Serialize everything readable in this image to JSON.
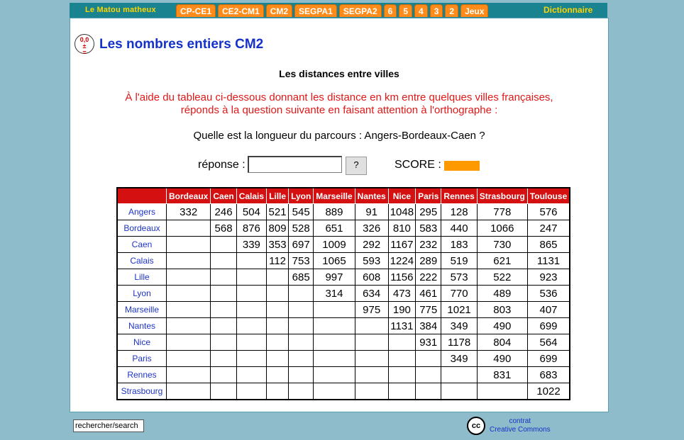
{
  "nav": {
    "brand": "Le Matou matheux",
    "tabs": [
      "CP-CE1",
      "CE2-CM1",
      "CM2",
      "SEGPA1",
      "SEGPA2",
      "6",
      "5",
      "4",
      "3",
      "2",
      "Jeux"
    ],
    "dictionary": "Dictionnaire"
  },
  "page": {
    "logo_text": "0,0\n+-\n=",
    "title": "Les nombres entiers CM2",
    "subtitle": "Les distances entre villes",
    "instructions_line1": "À l'aide du tableau ci-dessous donnant les distance en km entre quelques villes françaises,",
    "instructions_line2": "réponds à la question suivante en faisant attention à l'orthographe :",
    "question": "Quelle est la longueur du parcours : Angers-Bordeaux-Caen ?",
    "answer_label": "réponse :",
    "answer_value": "",
    "help_button": "?",
    "score_label": "SCORE :"
  },
  "table": {
    "columns": [
      "Bordeaux",
      "Caen",
      "Calais",
      "Lille",
      "Lyon",
      "Marseille",
      "Nantes",
      "Nice",
      "Paris",
      "Rennes",
      "Strasbourg",
      "Toulouse"
    ],
    "rows": [
      {
        "city": "Angers",
        "values": [
          "332",
          "246",
          "504",
          "521",
          "545",
          "889",
          "91",
          "1048",
          "295",
          "128",
          "778",
          "576"
        ]
      },
      {
        "city": "Bordeaux",
        "values": [
          "",
          "568",
          "876",
          "809",
          "528",
          "651",
          "326",
          "810",
          "583",
          "440",
          "1066",
          "247"
        ]
      },
      {
        "city": "Caen",
        "values": [
          "",
          "",
          "339",
          "353",
          "697",
          "1009",
          "292",
          "1167",
          "232",
          "183",
          "730",
          "865"
        ]
      },
      {
        "city": "Calais",
        "values": [
          "",
          "",
          "",
          "112",
          "753",
          "1065",
          "593",
          "1224",
          "289",
          "519",
          "621",
          "1131"
        ]
      },
      {
        "city": "Lille",
        "values": [
          "",
          "",
          "",
          "",
          "685",
          "997",
          "608",
          "1156",
          "222",
          "573",
          "522",
          "923"
        ]
      },
      {
        "city": "Lyon",
        "values": [
          "",
          "",
          "",
          "",
          "",
          "314",
          "634",
          "473",
          "461",
          "770",
          "489",
          "536"
        ]
      },
      {
        "city": "Marseille",
        "values": [
          "",
          "",
          "",
          "",
          "",
          "",
          "975",
          "190",
          "775",
          "1021",
          "803",
          "407"
        ]
      },
      {
        "city": "Nantes",
        "values": [
          "",
          "",
          "",
          "",
          "",
          "",
          "",
          "1131",
          "384",
          "349",
          "490",
          "699"
        ]
      },
      {
        "city": "Nice",
        "values": [
          "",
          "",
          "",
          "",
          "",
          "",
          "",
          "",
          "931",
          "1178",
          "804",
          "564"
        ]
      },
      {
        "city": "Paris",
        "values": [
          "",
          "",
          "",
          "",
          "",
          "",
          "",
          "",
          "",
          "349",
          "490",
          "699"
        ]
      },
      {
        "city": "Rennes",
        "values": [
          "",
          "",
          "",
          "",
          "",
          "",
          "",
          "",
          "",
          "",
          "831",
          "683"
        ]
      },
      {
        "city": "Strasbourg",
        "values": [
          "",
          "",
          "",
          "",
          "",
          "",
          "",
          "",
          "",
          "",
          "",
          "1022"
        ]
      }
    ]
  },
  "footer": {
    "search_value": "rechercher/search",
    "cc_icon": "cc",
    "license_line1": "contrat",
    "license_line2": "Creative Commons"
  },
  "colors": {
    "background": "#8fbcca",
    "navbar": "#19838f",
    "tab": "#ff8c1a",
    "header_red": "#d41010",
    "link_blue": "#1432c8",
    "score": "#ff9900"
  }
}
